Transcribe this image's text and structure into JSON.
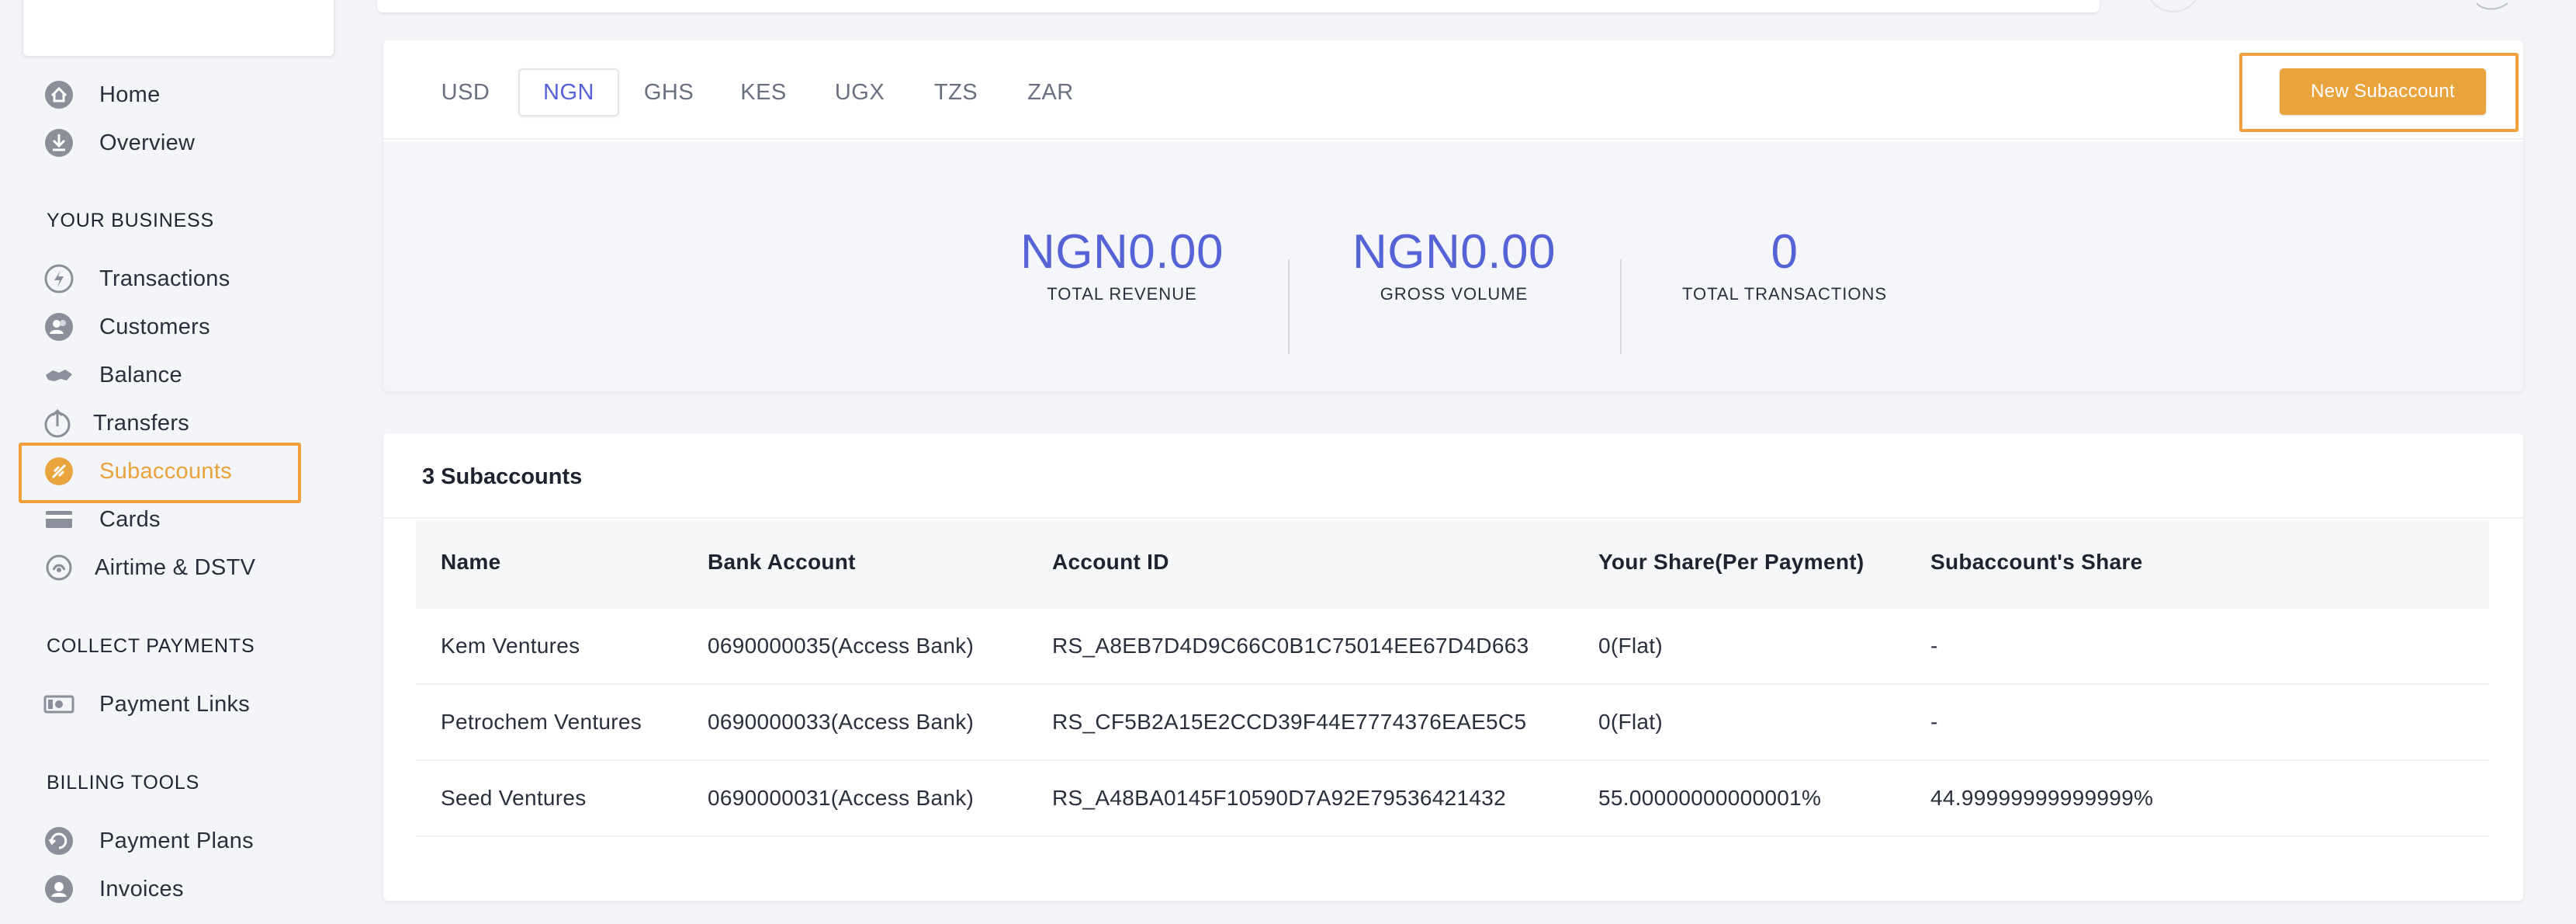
{
  "sidebar": {
    "items": [
      {
        "label": "Home",
        "icon": "home-icon"
      },
      {
        "label": "Overview",
        "icon": "overview-icon"
      }
    ],
    "sections": [
      {
        "title": "YOUR BUSINESS",
        "items": [
          {
            "label": "Transactions",
            "icon": "transactions-icon"
          },
          {
            "label": "Customers",
            "icon": "customers-icon"
          },
          {
            "label": "Balance",
            "icon": "balance-icon"
          },
          {
            "label": "Transfers",
            "icon": "transfers-icon"
          },
          {
            "label": "Subaccounts",
            "icon": "subaccounts-icon",
            "active": true
          },
          {
            "label": "Cards",
            "icon": "cards-icon"
          },
          {
            "label": "Airtime & DSTV",
            "icon": "airtime-icon"
          }
        ]
      },
      {
        "title": "COLLECT PAYMENTS",
        "items": [
          {
            "label": "Payment Links",
            "icon": "payment-links-icon"
          }
        ]
      },
      {
        "title": "BILLING TOOLS",
        "items": [
          {
            "label": "Payment Plans",
            "icon": "payment-plans-icon"
          },
          {
            "label": "Invoices",
            "icon": "invoices-icon"
          }
        ]
      }
    ]
  },
  "currencies": {
    "tabs": [
      "USD",
      "NGN",
      "GHS",
      "KES",
      "UGX",
      "TZS",
      "ZAR"
    ],
    "selected": "NGN"
  },
  "new_subaccount_button": "New Subaccount",
  "stats": [
    {
      "value": "NGN0.00",
      "label": "TOTAL REVENUE"
    },
    {
      "value": "NGN0.00",
      "label": "GROSS VOLUME"
    },
    {
      "value": "0",
      "label": "TOTAL TRANSACTIONS"
    }
  ],
  "subaccounts": {
    "title": "3 Subaccounts",
    "columns": [
      "Name",
      "Bank Account",
      "Account ID",
      "Your Share(Per Payment)",
      "Subaccount's Share"
    ],
    "rows": [
      [
        "Kem Ventures",
        "0690000035(Access Bank)",
        "RS_A8EB7D4D9C66C0B1C75014EE67D4D663",
        "0(Flat)",
        "-"
      ],
      [
        "Petrochem Ventures",
        "0690000033(Access Bank)",
        "RS_CF5B2A15E2CCD39F44E7774376EAE5C5",
        "0(Flat)",
        "-"
      ],
      [
        "Seed Ventures",
        "0690000031(Access Bank)",
        "RS_A48BA0145F10590D7A92E79536421432",
        "55.00000000000001%",
        "44.99999999999999%"
      ]
    ]
  },
  "colors": {
    "accent": "#eaa43e",
    "primary_value": "#5563d6",
    "highlight_border": "#f0a03c"
  }
}
